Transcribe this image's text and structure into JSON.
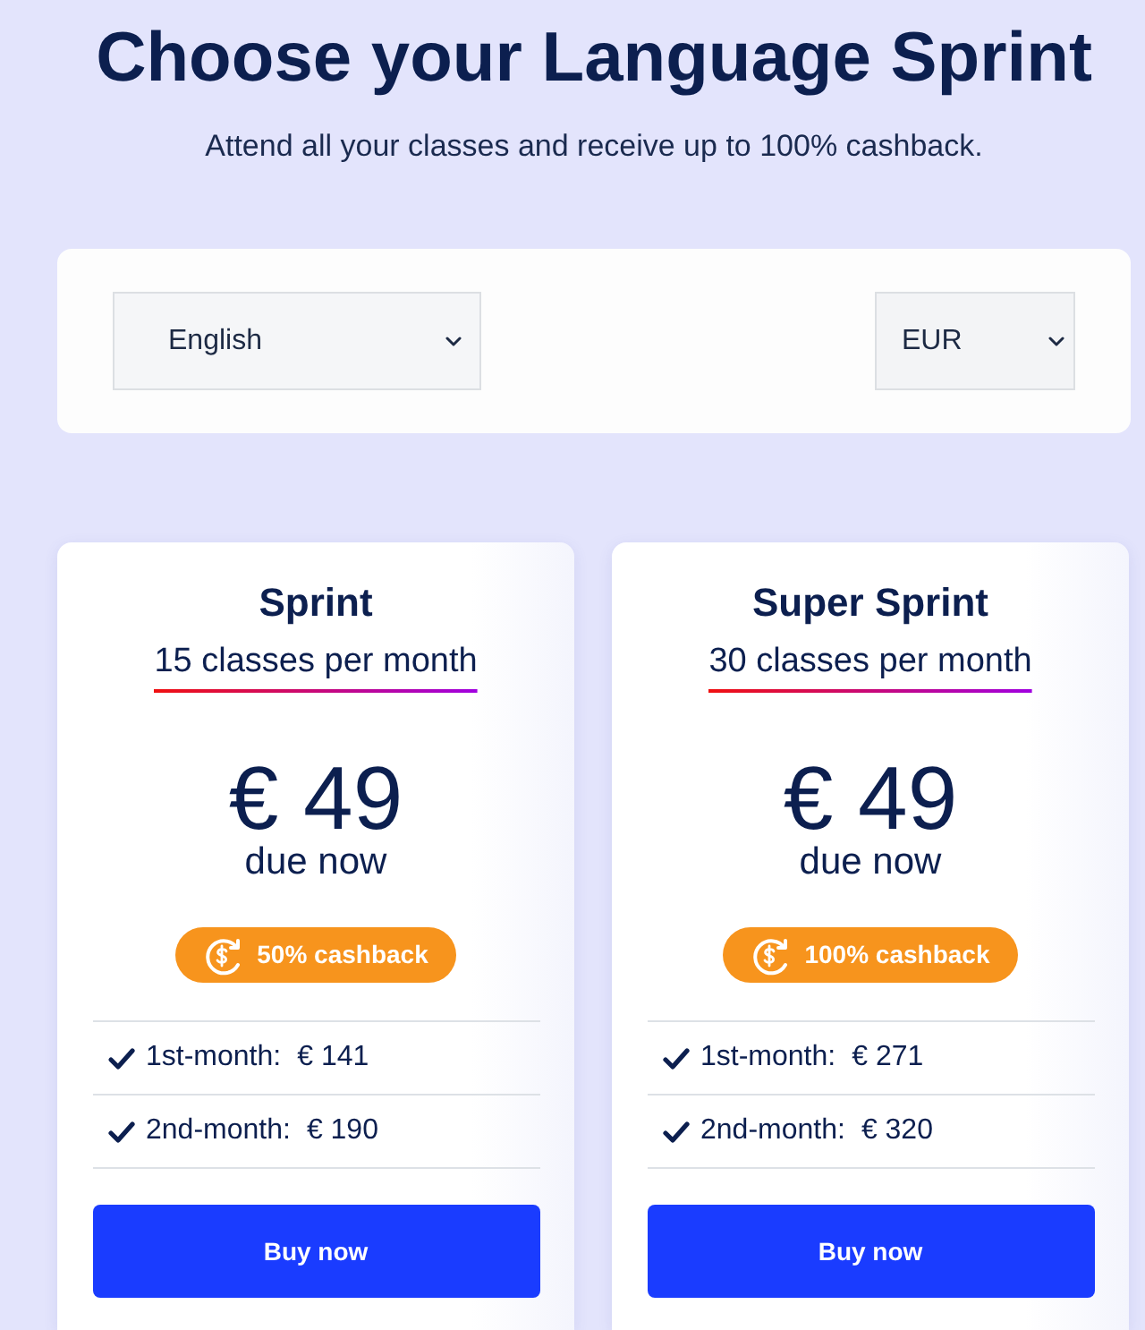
{
  "header": {
    "title": "Choose your Language Sprint",
    "subtitle": "Attend all your classes and receive up to 100% cashback."
  },
  "filters": {
    "language_select": {
      "value": "English"
    },
    "currency_select": {
      "value": "EUR"
    }
  },
  "plans": [
    {
      "name": "Sprint",
      "classes": "15 classes per month",
      "price": "€ 49",
      "price_note": "due now",
      "cashback": "50% cashback",
      "payments": [
        {
          "label": "1st-month:",
          "amount": "€ 141"
        },
        {
          "label": "2nd-month:",
          "amount": "€ 190"
        }
      ],
      "button": "Buy now"
    },
    {
      "name": "Super Sprint",
      "classes": "30 classes per month",
      "price": "€ 49",
      "price_note": "due now",
      "cashback": "100% cashback",
      "payments": [
        {
          "label": "1st-month:",
          "amount": "€ 271"
        },
        {
          "label": "2nd-month:",
          "amount": "€ 320"
        }
      ],
      "button": "Buy now"
    }
  ]
}
